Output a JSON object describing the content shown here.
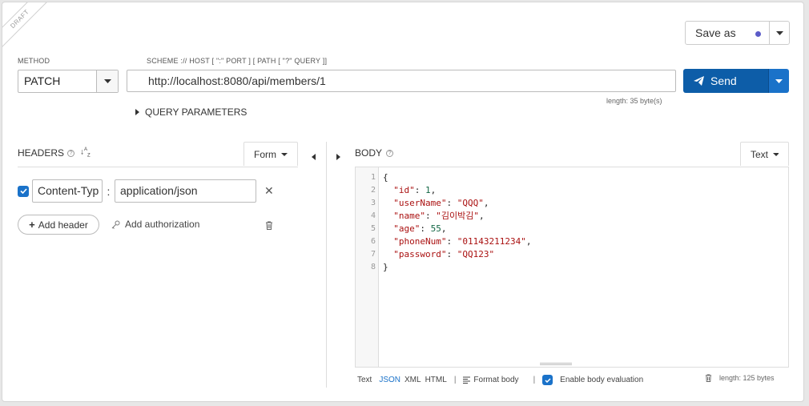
{
  "ribbon": "DRAFT",
  "save_as": {
    "label": "Save as",
    "accent": "#5b5bc8"
  },
  "method": {
    "label": "METHOD",
    "value": "PATCH"
  },
  "url": {
    "label": "SCHEME :// HOST [ \":\" PORT ] [ PATH [ \"?\" QUERY ]]",
    "value": "http://localhost:8080/api/members/1",
    "length": "length: 35 byte(s)"
  },
  "send": {
    "label": "Send",
    "color": "#0d5da8"
  },
  "query_parameters": "QUERY PARAMETERS",
  "headers": {
    "title": "HEADERS",
    "mode": "Form",
    "rows": [
      {
        "key": "Content-Typ",
        "value": "application/json",
        "enabled": true
      }
    ],
    "add_header": "Add header",
    "add_authorization": "Add authorization"
  },
  "body": {
    "title": "BODY",
    "mode": "Text",
    "line_numbers": [
      "1",
      "2",
      "3",
      "4",
      "5",
      "6",
      "7",
      "8"
    ],
    "json": {
      "id": 1,
      "userName": "QQQ",
      "name": "김이박김",
      "age": 55,
      "phoneNum": "01143211234",
      "password": "QQ123"
    },
    "formats": [
      "Text",
      "JSON",
      "XML",
      "HTML"
    ],
    "selected_format": "JSON",
    "separator": "|",
    "format_body": "Format body",
    "enable_eval": "Enable body evaluation",
    "length": "length: 125 bytes"
  }
}
